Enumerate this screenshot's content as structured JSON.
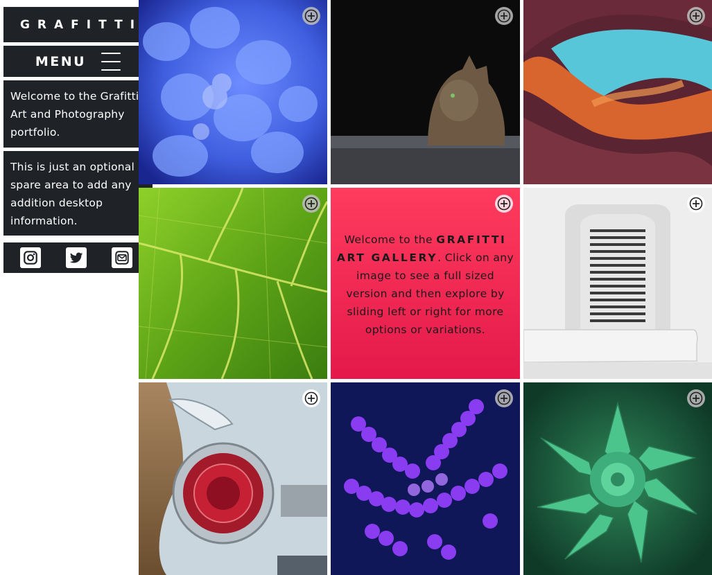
{
  "sidebar": {
    "logo": "GRAFITTI",
    "menu_label": "MENU",
    "info_1": "Welcome to the Grafitti Art and Photography portfolio.",
    "info_2": "This is just an optional spare area to add any addition desktop information.",
    "social_icons": [
      "instagram-icon",
      "twitter-icon",
      "mail-icon"
    ]
  },
  "gallery": {
    "welcome_pre": "Welcome to the",
    "welcome_brand_1": "GRAFITTI",
    "welcome_brand_2": "ART GALLERY",
    "welcome_post": ". Click on any image to see a full sized version and then explore by sliding left or right for more options or variations.",
    "tiles": [
      {
        "name": "hydrangea-photo"
      },
      {
        "name": "cat-photo"
      },
      {
        "name": "canyon-photo"
      },
      {
        "name": "leaf-photo"
      },
      {
        "name": "welcome-card"
      },
      {
        "name": "white-window-photo"
      },
      {
        "name": "car-taillight-photo"
      },
      {
        "name": "purple-bubbles-photo"
      },
      {
        "name": "succulent-photo"
      }
    ]
  },
  "colors": {
    "panel_bg": "#1f2227",
    "welcome_card_top": "#ff3b5e",
    "welcome_card_bottom": "#e4194a"
  }
}
